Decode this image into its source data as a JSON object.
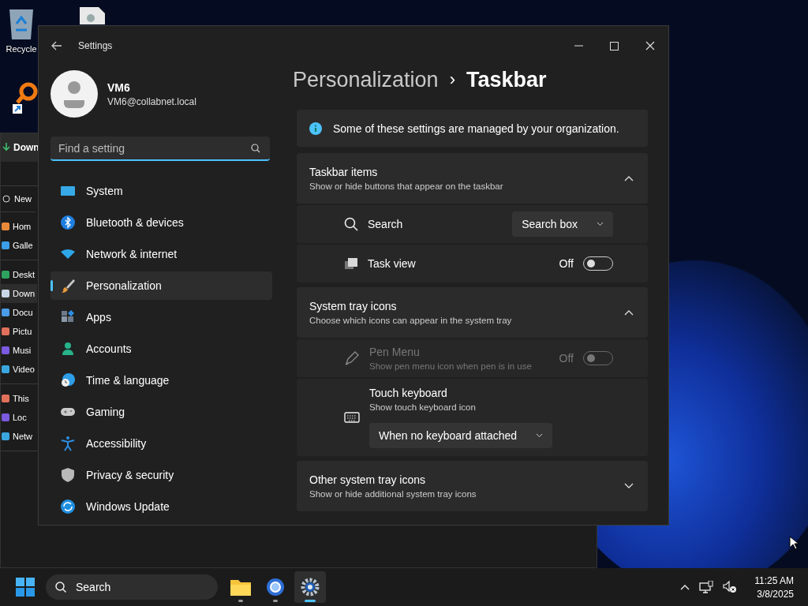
{
  "desktop_icons": [
    {
      "label": "Recycle"
    }
  ],
  "explorer": {
    "title": "Down",
    "new_button": "New",
    "nav_groups": [
      [
        {
          "label": "Hom",
          "selected": false
        },
        {
          "label": "Galle",
          "selected": false
        }
      ],
      [
        {
          "label": "Deskt",
          "selected": false
        },
        {
          "label": "Down",
          "selected": true
        },
        {
          "label": "Docu",
          "selected": false
        },
        {
          "label": "Pictu",
          "selected": false
        },
        {
          "label": "Musi",
          "selected": false
        },
        {
          "label": "Video",
          "selected": false
        }
      ],
      [
        {
          "label": "This",
          "selected": false
        },
        {
          "label": "Loc",
          "selected": false
        },
        {
          "label": "Netw",
          "selected": false
        }
      ]
    ]
  },
  "settings": {
    "window": {
      "title": "Settings"
    },
    "user": {
      "name": "VM6",
      "email": "VM6@collabnet.local"
    },
    "search": {
      "placeholder": "Find a setting"
    },
    "nav": [
      {
        "label": "System",
        "selected": false
      },
      {
        "label": "Bluetooth & devices",
        "selected": false
      },
      {
        "label": "Network & internet",
        "selected": false
      },
      {
        "label": "Personalization",
        "selected": true
      },
      {
        "label": "Apps",
        "selected": false
      },
      {
        "label": "Accounts",
        "selected": false
      },
      {
        "label": "Time & language",
        "selected": false
      },
      {
        "label": "Gaming",
        "selected": false
      },
      {
        "label": "Accessibility",
        "selected": false
      },
      {
        "label": "Privacy & security",
        "selected": false
      },
      {
        "label": "Windows Update",
        "selected": false
      }
    ],
    "breadcrumb": {
      "parent": "Personalization",
      "separator": "›",
      "current": "Taskbar"
    },
    "notice": "Some of these settings are managed by your organization.",
    "sections": [
      {
        "title": "Taskbar items",
        "subtitle": "Show or hide buttons that appear on the taskbar",
        "expanded": true,
        "rows": [
          {
            "kind": "dropdown",
            "label": "Search",
            "value": "Search box",
            "disabled": false
          },
          {
            "kind": "toggle",
            "label": "Task view",
            "state_label": "Off",
            "on": false,
            "disabled": false
          }
        ]
      },
      {
        "title": "System tray icons",
        "subtitle": "Choose which icons can appear in the system tray",
        "expanded": true,
        "rows": [
          {
            "kind": "toggle",
            "label": "Pen Menu",
            "subtitle": "Show pen menu icon when pen is in use",
            "state_label": "Off",
            "on": false,
            "disabled": true
          },
          {
            "kind": "dropdown-below",
            "label": "Touch keyboard",
            "subtitle": "Show touch keyboard icon",
            "value": "When no keyboard attached",
            "disabled": false
          }
        ]
      },
      {
        "title": "Other system tray icons",
        "subtitle": "Show or hide additional system tray icons",
        "expanded": false
      }
    ]
  },
  "taskbar": {
    "search": "Search",
    "apps": [
      {
        "selected": false
      },
      {
        "selected": false
      },
      {
        "selected": true
      }
    ],
    "time": "11:25 AM",
    "date": "3/8/2025"
  }
}
